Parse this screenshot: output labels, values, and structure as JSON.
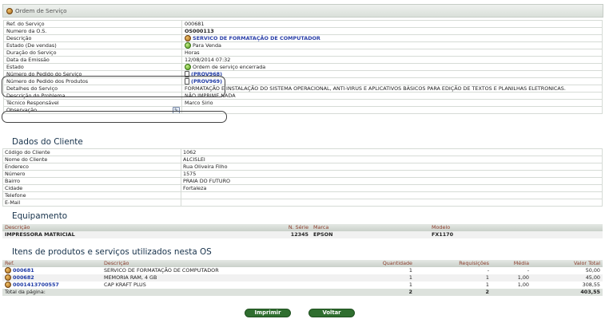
{
  "panel": {
    "title": "Ordem de Serviço"
  },
  "os": [
    {
      "label": "Ref. do Serviço",
      "value": "000681"
    },
    {
      "label": "Numero da O.S.",
      "value": "OS000113"
    },
    {
      "label": "Descrição",
      "value": "SERVICO DE FORMATAÇÃO DE COMPUTADOR"
    },
    {
      "label": "Estado (De vendas)",
      "value": "Para Venda"
    },
    {
      "label": "Duração do Serviço",
      "value": "Horas"
    },
    {
      "label": "Data da Emissão",
      "value": "12/08/2014 07:32"
    },
    {
      "label": "Estado",
      "value": "Ordem de serviço encerrada"
    },
    {
      "label": "Número do Pedido do Serviço",
      "value": "(PROV968)"
    },
    {
      "label": "Número do Pedido dos Produtos",
      "value": "(PROV969)"
    },
    {
      "label": "Detalhes do Serviço",
      "value": "FORMATAÇÃO E INSTALAÇÃO DO SISTEMA OPERACIONAL, ANTI-VIRUS E APLICATIVOS BÁSICOS PARA EDIÇÃO DE TEXTOS E PLANILHAS ELETRONICAS."
    },
    {
      "label": "Descrição do Problema",
      "value": "NÃO IMPRIME NADA"
    },
    {
      "label": "Técnico Responsável",
      "value": "Marco Sirio"
    },
    {
      "label": "Observação",
      "value": ""
    }
  ],
  "cliente": {
    "title": "Dados do Cliente",
    "rows": [
      {
        "label": "Código do Cliente",
        "value": "1062"
      },
      {
        "label": "Nome do Cliente",
        "value": "ALCISLEI"
      },
      {
        "label": "Endereco",
        "value": "Rua Oliveira Filho"
      },
      {
        "label": "Número",
        "value": "1575"
      },
      {
        "label": "Bairro",
        "value": "PRAIA DO FUTURO"
      },
      {
        "label": "Cidade",
        "value": "Fortaleza"
      },
      {
        "label": "Telefone",
        "value": ""
      },
      {
        "label": "E-Mail",
        "value": ""
      }
    ]
  },
  "equip": {
    "title": "Equipamento",
    "headers": {
      "descricao": "Descrição",
      "serie": "N. Série",
      "marca": "Marca",
      "modelo": "Modelo"
    },
    "row": {
      "descricao": "IMPRESSORA MATRICIAL",
      "serie": "12345",
      "marca": "EPSON",
      "modelo": "FX1170"
    }
  },
  "itens": {
    "title": "Itens de produtos e serviços utilizados nesta OS",
    "headers": {
      "ref": "Ref.",
      "descricao": "Descrição",
      "quantidade": "Quantidade",
      "requisicoes": "Requisições",
      "media": "Média",
      "valor": "Valor Total"
    },
    "rows": [
      {
        "ref": "000681",
        "descricao": "SERVICO DE FORMATAÇÃO DE COMPUTADOR",
        "quantidade": "1",
        "requisicoes": "-",
        "media": "-",
        "valor": "50,00"
      },
      {
        "ref": "000682",
        "descricao": "MEMORIA RAM, 4 GB",
        "quantidade": "1",
        "requisicoes": "1",
        "media": "1,00",
        "valor": "45,00"
      },
      {
        "ref": "0001413700557",
        "descricao": "CAP KRAFT PLUS",
        "quantidade": "1",
        "requisicoes": "1",
        "media": "1,00",
        "valor": "308,55"
      }
    ],
    "total": {
      "label": "Total da página:",
      "quantidade": "2",
      "requisicoes": "2",
      "valor": "403,55"
    }
  },
  "buttons": {
    "imprimir": "Imprimir",
    "voltar": "Voltar"
  }
}
